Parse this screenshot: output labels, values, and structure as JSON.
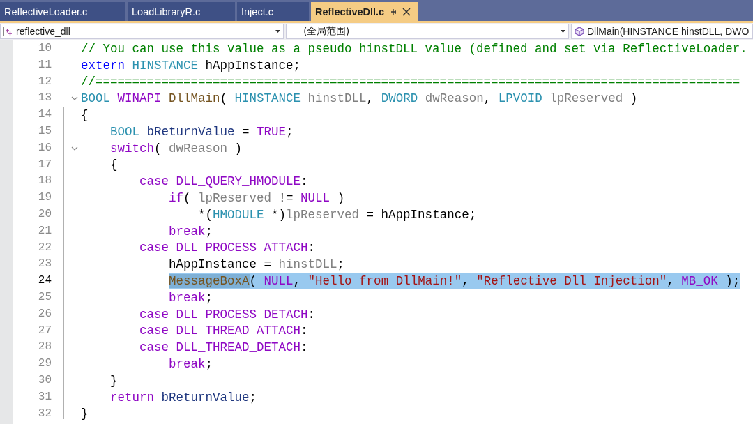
{
  "tabs": [
    {
      "label": "ReflectiveLoader.c",
      "selected": false
    },
    {
      "label": "LoadLibraryR.c",
      "selected": false
    },
    {
      "label": "Inject.c",
      "selected": false
    },
    {
      "label": "ReflectiveDll.c",
      "selected": true
    }
  ],
  "navigation_bar": {
    "project": "reflective_dll",
    "scope": "(全局范围)",
    "member": "DllMain(HINSTANCE hinstDLL, DWO"
  },
  "lines": [
    {
      "number": "10",
      "fold_marker": false,
      "selected": false,
      "tokens": [
        {
          "kind": "comment",
          "text": "// You can use this value as a pseudo hinstDLL value (defined and set via ReflectiveLoader."
        }
      ]
    },
    {
      "number": "11",
      "fold_marker": false,
      "selected": false,
      "tokens": [
        {
          "kind": "keyword",
          "text": "extern "
        },
        {
          "kind": "type",
          "text": "HINSTANCE"
        },
        {
          "kind": "plain",
          "text": " hAppInstance;"
        }
      ]
    },
    {
      "number": "12",
      "fold_marker": false,
      "selected": false,
      "tokens": [
        {
          "kind": "comment",
          "text": "//========================================================================================"
        }
      ]
    },
    {
      "number": "13",
      "fold_marker": true,
      "selected": false,
      "tokens": [
        {
          "kind": "type",
          "text": "BOOL "
        },
        {
          "kind": "macro",
          "text": "WINAPI "
        },
        {
          "kind": "function",
          "text": "DllMain"
        },
        {
          "kind": "plain",
          "text": "( "
        },
        {
          "kind": "type",
          "text": "HINSTANCE "
        },
        {
          "kind": "param",
          "text": "hinstDLL"
        },
        {
          "kind": "plain",
          "text": ", "
        },
        {
          "kind": "type",
          "text": "DWORD "
        },
        {
          "kind": "param",
          "text": "dwReason"
        },
        {
          "kind": "plain",
          "text": ", "
        },
        {
          "kind": "type",
          "text": "LPVOID "
        },
        {
          "kind": "param",
          "text": "lpReserved"
        },
        {
          "kind": "plain",
          "text": " )"
        }
      ]
    },
    {
      "number": "14",
      "fold_marker": false,
      "selected": false,
      "tokens": [
        {
          "kind": "plain",
          "text": "{"
        }
      ]
    },
    {
      "number": "15",
      "fold_marker": false,
      "selected": false,
      "tokens": [
        {
          "kind": "type",
          "text": "    BOOL "
        },
        {
          "kind": "local",
          "text": "bReturnValue"
        },
        {
          "kind": "plain",
          "text": " = "
        },
        {
          "kind": "macro",
          "text": "TRUE"
        },
        {
          "kind": "plain",
          "text": ";"
        }
      ]
    },
    {
      "number": "16",
      "fold_marker": true,
      "selected": false,
      "tokens": [
        {
          "kind": "control",
          "text": "    switch"
        },
        {
          "kind": "plain",
          "text": "( "
        },
        {
          "kind": "param",
          "text": "dwReason"
        },
        {
          "kind": "plain",
          "text": " )"
        }
      ]
    },
    {
      "number": "17",
      "fold_marker": false,
      "selected": false,
      "tokens": [
        {
          "kind": "plain",
          "text": "    {"
        }
      ]
    },
    {
      "number": "18",
      "fold_marker": false,
      "selected": false,
      "tokens": [
        {
          "kind": "control",
          "text": "        case "
        },
        {
          "kind": "macro",
          "text": "DLL_QUERY_HMODULE"
        },
        {
          "kind": "plain",
          "text": ":"
        }
      ]
    },
    {
      "number": "19",
      "fold_marker": false,
      "selected": false,
      "tokens": [
        {
          "kind": "control",
          "text": "            if"
        },
        {
          "kind": "plain",
          "text": "( "
        },
        {
          "kind": "param",
          "text": "lpReserved"
        },
        {
          "kind": "plain",
          "text": " != "
        },
        {
          "kind": "macro",
          "text": "NULL"
        },
        {
          "kind": "plain",
          "text": " )"
        }
      ]
    },
    {
      "number": "20",
      "fold_marker": false,
      "selected": false,
      "tokens": [
        {
          "kind": "plain",
          "text": "                *("
        },
        {
          "kind": "type",
          "text": "HMODULE"
        },
        {
          "kind": "plain",
          "text": " *)"
        },
        {
          "kind": "param",
          "text": "lpReserved"
        },
        {
          "kind": "plain",
          "text": " = hAppInstance;"
        }
      ]
    },
    {
      "number": "21",
      "fold_marker": false,
      "selected": false,
      "tokens": [
        {
          "kind": "control",
          "text": "            break"
        },
        {
          "kind": "plain",
          "text": ";"
        }
      ]
    },
    {
      "number": "22",
      "fold_marker": false,
      "selected": false,
      "tokens": [
        {
          "kind": "control",
          "text": "        case "
        },
        {
          "kind": "macro",
          "text": "DLL_PROCESS_ATTACH"
        },
        {
          "kind": "plain",
          "text": ":"
        }
      ]
    },
    {
      "number": "23",
      "fold_marker": false,
      "selected": false,
      "tokens": [
        {
          "kind": "plain",
          "text": "            hAppInstance = "
        },
        {
          "kind": "param",
          "text": "hinstDLL"
        },
        {
          "kind": "plain",
          "text": ";"
        }
      ]
    },
    {
      "number": "24",
      "fold_marker": false,
      "selected": true,
      "tokens": [
        {
          "kind": "function_match",
          "text": "            MessageBoxA"
        },
        {
          "kind": "plain",
          "text": "( "
        },
        {
          "kind": "macro",
          "text": "NULL"
        },
        {
          "kind": "plain",
          "text": ", "
        },
        {
          "kind": "string",
          "text": "\"Hello from DllMain!\""
        },
        {
          "kind": "plain",
          "text": ", "
        },
        {
          "kind": "string",
          "text": "\"Reflective Dll Injection\""
        },
        {
          "kind": "plain",
          "text": ", "
        },
        {
          "kind": "macro",
          "text": "MB_OK"
        },
        {
          "kind": "plain",
          "text": " );"
        }
      ]
    },
    {
      "number": "25",
      "fold_marker": false,
      "selected": false,
      "tokens": [
        {
          "kind": "control",
          "text": "            break"
        },
        {
          "kind": "plain",
          "text": ";"
        }
      ]
    },
    {
      "number": "26",
      "fold_marker": false,
      "selected": false,
      "tokens": [
        {
          "kind": "control",
          "text": "        case "
        },
        {
          "kind": "macro",
          "text": "DLL_PROCESS_DETACH"
        },
        {
          "kind": "plain",
          "text": ":"
        }
      ]
    },
    {
      "number": "27",
      "fold_marker": false,
      "selected": false,
      "tokens": [
        {
          "kind": "control",
          "text": "        case "
        },
        {
          "kind": "macro",
          "text": "DLL_THREAD_ATTACH"
        },
        {
          "kind": "plain",
          "text": ":"
        }
      ]
    },
    {
      "number": "28",
      "fold_marker": false,
      "selected": false,
      "tokens": [
        {
          "kind": "control",
          "text": "        case "
        },
        {
          "kind": "macro",
          "text": "DLL_THREAD_DETACH"
        },
        {
          "kind": "plain",
          "text": ":"
        }
      ]
    },
    {
      "number": "29",
      "fold_marker": false,
      "selected": false,
      "tokens": [
        {
          "kind": "control",
          "text": "            break"
        },
        {
          "kind": "plain",
          "text": ";"
        }
      ]
    },
    {
      "number": "30",
      "fold_marker": false,
      "selected": false,
      "tokens": [
        {
          "kind": "plain",
          "text": "    }"
        }
      ]
    },
    {
      "number": "31",
      "fold_marker": false,
      "selected": false,
      "tokens": [
        {
          "kind": "control",
          "text": "    return "
        },
        {
          "kind": "local",
          "text": "bReturnValue"
        },
        {
          "kind": "plain",
          "text": ";"
        }
      ]
    },
    {
      "number": "32",
      "fold_marker": false,
      "selected": false,
      "tokens": [
        {
          "kind": "plain",
          "text": "}"
        }
      ]
    }
  ]
}
